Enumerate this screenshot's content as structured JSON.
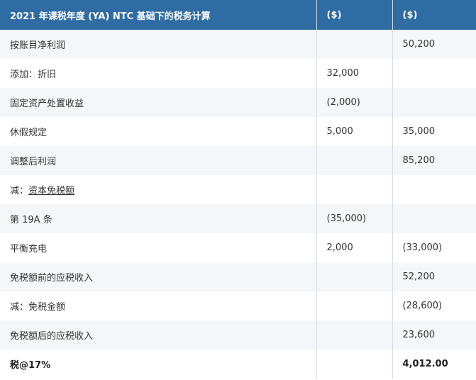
{
  "table": {
    "headers": [
      "2021 年课税年度 (YA) NTC 基础下的税务计算",
      "($)",
      "($)"
    ],
    "rows": [
      {
        "label": "按账目净利润",
        "col1": "",
        "col2": "50,200"
      },
      {
        "label": "添加：折旧",
        "col1": "32,000",
        "col2": ""
      },
      {
        "label": "固定资产处置收益",
        "col1": "(2,000)",
        "col2": ""
      },
      {
        "label": "休假规定",
        "col1": "5,000",
        "col2": "35,000"
      },
      {
        "label": "调整后利润",
        "col1": "",
        "col2": "85,200"
      },
      {
        "label_prefix": "减：",
        "label_link": "资本免税额",
        "col1": "",
        "col2": ""
      },
      {
        "label": "第 19A 条",
        "col1": "(35,000)",
        "col2": ""
      },
      {
        "label": "平衡充电",
        "col1": "2,000",
        "col2": "(33,000)"
      },
      {
        "label": "免税额前的应税收入",
        "col1": "",
        "col2": "52,200"
      },
      {
        "label": "减：免税金额",
        "col1": "",
        "col2": "(28,600)"
      },
      {
        "label": "免税额后的应税收入",
        "col1": "",
        "col2": "23,600"
      },
      {
        "label": "税@17%",
        "col1": "",
        "col2": "4,012.00"
      }
    ]
  }
}
